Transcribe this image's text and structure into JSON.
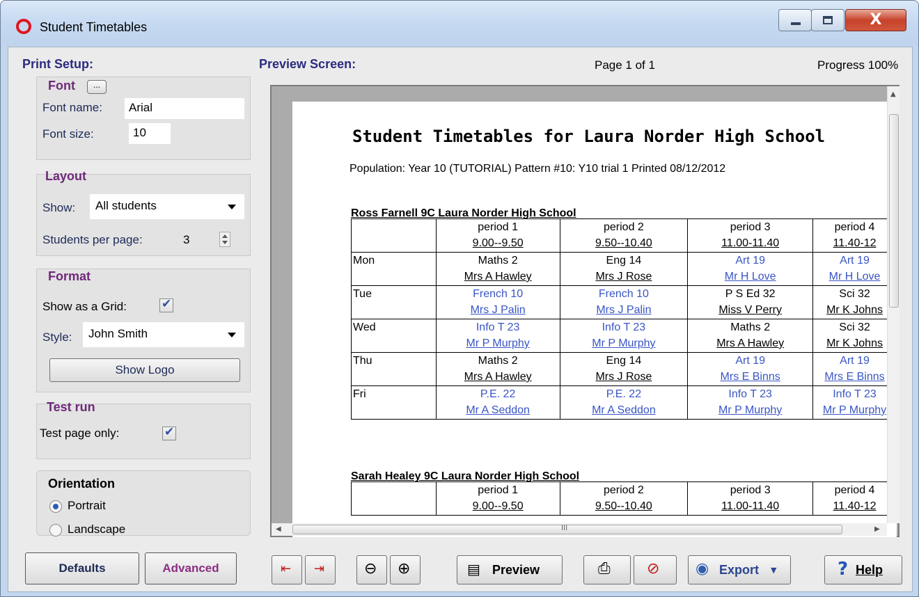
{
  "window": {
    "title": "Student Timetables",
    "close_glyph": "X"
  },
  "print_setup": {
    "heading": "Print Setup:",
    "font": {
      "title": "Font",
      "dots": "...",
      "name_label": "Font name:",
      "name_value": "Arial",
      "size_label": "Font size:",
      "size_value": "10"
    },
    "layout": {
      "title": "Layout",
      "show_label": "Show:",
      "show_value": "All students",
      "spp_label": "Students per page:",
      "spp_value": "3"
    },
    "format": {
      "title": "Format",
      "grid_label": "Show as a Grid:",
      "style_label": "Style:",
      "style_value": "John Smith",
      "logo_button": "Show Logo"
    },
    "test_run": {
      "title": "Test run",
      "test_label": "Test page only:"
    },
    "orientation": {
      "title": "Orientation",
      "portrait": "Portrait",
      "landscape": "Landscape"
    },
    "defaults_button": "Defaults",
    "advanced_button": "Advanced"
  },
  "preview": {
    "heading": "Preview Screen:",
    "page_info": "Page 1 of 1",
    "progress": "Progress 100%",
    "scroll_grip": "III",
    "doc_title": "Student Timetables for Laura Norder High School",
    "doc_subtitle": "Population: Year 10 (TUTORIAL)    Pattern #10: Y10  trial 1   Printed  08/12/2012",
    "students": [
      {
        "heading": "Ross Farnell  9C    Laura Norder High School",
        "periods": [
          [
            "period 1",
            "9.00--9.50"
          ],
          [
            "period 2",
            "9.50--10.40"
          ],
          [
            "period 3",
            "11.00-11.40"
          ],
          [
            "period 4",
            "11.40-12"
          ]
        ],
        "rows": [
          {
            "day": "Mon",
            "cells": [
              [
                "Maths   2",
                "Mrs A Hawley",
                "black"
              ],
              [
                "Eng   14",
                "Mrs J Rose",
                "black"
              ],
              [
                "Art   19",
                "Mr H Love",
                "blue"
              ],
              [
                "Art   19",
                "Mr H Love",
                "blue"
              ]
            ]
          },
          {
            "day": "Tue",
            "cells": [
              [
                "French   10",
                "Mrs J Palin",
                "blue"
              ],
              [
                "French   10",
                "Mrs J Palin",
                "blue"
              ],
              [
                "P S Ed   32",
                "Miss V Perry",
                "black"
              ],
              [
                "Sci   32",
                "Mr K Johns",
                "black"
              ]
            ]
          },
          {
            "day": "Wed",
            "cells": [
              [
                "Info T    23",
                "Mr P Murphy",
                "blue"
              ],
              [
                "Info T    23",
                "Mr P Murphy",
                "blue"
              ],
              [
                "Maths   2",
                "Mrs A Hawley",
                "black"
              ],
              [
                "Sci   32",
                "Mr K Johns",
                "black"
              ]
            ]
          },
          {
            "day": "Thu",
            "cells": [
              [
                "Maths   2",
                "Mrs A Hawley",
                "black"
              ],
              [
                "Eng   14",
                "Mrs J Rose",
                "black"
              ],
              [
                "Art   19",
                "Mrs E Binns",
                "blue"
              ],
              [
                "Art   19",
                "Mrs E Binns",
                "blue"
              ]
            ]
          },
          {
            "day": "Fri",
            "cells": [
              [
                "P.E.    22",
                "Mr A Seddon",
                "blue"
              ],
              [
                "P.E.    22",
                "Mr A Seddon",
                "blue"
              ],
              [
                "Info T    23",
                "Mr P Murphy",
                "blue"
              ],
              [
                "Info T    23",
                "Mr P Murphy",
                "blue"
              ]
            ]
          }
        ]
      },
      {
        "heading": "Sarah Healey  9C    Laura Norder High School",
        "periods": [
          [
            "period 1",
            "9.00--9.50"
          ],
          [
            "period 2",
            "9.50--10.40"
          ],
          [
            "period 3",
            "11.00-11.40"
          ],
          [
            "period 4",
            "11.40-12"
          ]
        ],
        "rows": []
      }
    ]
  },
  "toolbar": {
    "preview": "Preview",
    "export": "Export",
    "help": "Help",
    "help_glyph": "?"
  },
  "colors": {
    "accent_blue": "#3955c4",
    "heading_navy": "#2b2b80",
    "group_purple": "#6e2a79"
  }
}
